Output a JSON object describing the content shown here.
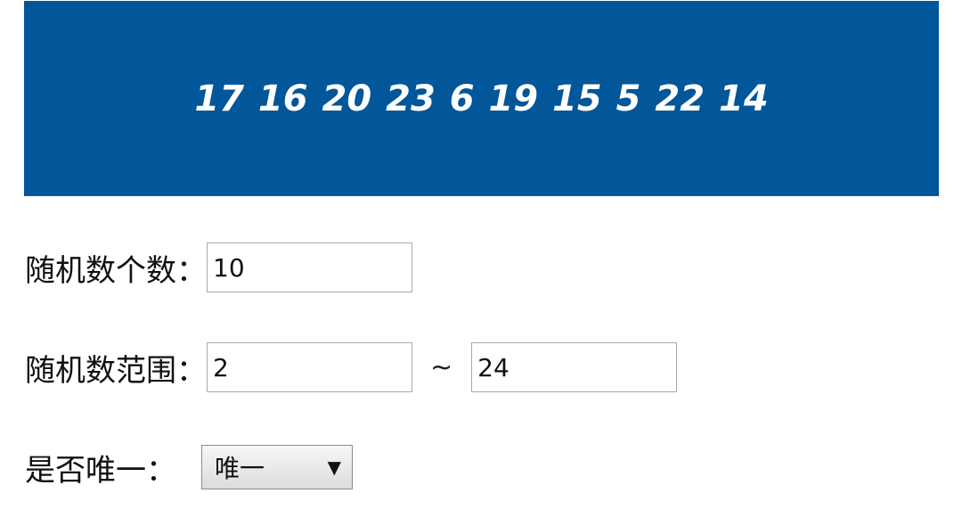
{
  "result": {
    "numbers": "17 16 20 23 6 19 15 5 22 14"
  },
  "count": {
    "label": "随机数个数：",
    "value": "10"
  },
  "range": {
    "label": "随机数范围：",
    "min": "2",
    "separator": "~",
    "max": "24"
  },
  "unique": {
    "label": "是否唯一：",
    "selected": "唯一",
    "arrow_icon": "triangle-down-icon"
  },
  "colors": {
    "banner_background": "#02569a",
    "banner_text": "#ffffff"
  }
}
